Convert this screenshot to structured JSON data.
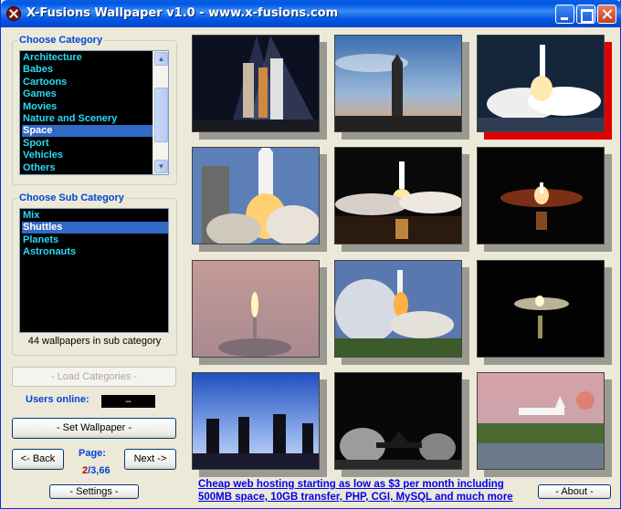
{
  "window": {
    "title": "X-Fusions Wallpaper v1.0  -  www.x-fusions.com"
  },
  "category": {
    "label": "Choose Category",
    "items": [
      "Architecture",
      "Babes",
      "Cartoons",
      "Games",
      "Movies",
      "Nature and Scenery",
      "Space",
      "Sport",
      "Vehicles",
      "Others"
    ],
    "selected": "Space"
  },
  "subcategory": {
    "label": "Choose Sub Category",
    "items": [
      "Mix",
      "Shuttles",
      "Planets",
      "Astronauts"
    ],
    "selected": "Shuttles",
    "count_text": "44 wallpapers in sub category"
  },
  "buttons": {
    "load_categories": "- Load Categories -",
    "set_wallpaper": "- Set Wallpaper -",
    "back": "<- Back",
    "next": "Next ->",
    "settings": "- Settings -",
    "about": "- About -"
  },
  "users_online": {
    "label": "Users online:",
    "value": "–"
  },
  "page": {
    "label": "Page:",
    "current": "2",
    "total": "/3,66"
  },
  "ad": {
    "line1": "Cheap web hosting starting as low as $3 per month including",
    "line2": "500MB space, 10GB transfer, PHP, CGI, MySQL and much more"
  },
  "thumbnails": [
    {
      "scene": "launchpad-night",
      "selected": false
    },
    {
      "scene": "shuttle-sunset-pad",
      "selected": false
    },
    {
      "scene": "liftoff-day-clouds",
      "selected": true
    },
    {
      "scene": "liftoff-tower-closeup",
      "selected": false
    },
    {
      "scene": "liftoff-night-reflection",
      "selected": false
    },
    {
      "scene": "liftoff-dark-water",
      "selected": false
    },
    {
      "scene": "ascent-dusk-plume",
      "selected": false
    },
    {
      "scene": "liftoff-evening-smoke",
      "selected": false
    },
    {
      "scene": "night-launch-distant",
      "selected": false
    },
    {
      "scene": "photographers-silhouette",
      "selected": false
    },
    {
      "scene": "shuttle-landing-night",
      "selected": false
    },
    {
      "scene": "shuttle-landing-runway",
      "selected": false
    }
  ],
  "colors": {
    "list_text": "#2bd9f5",
    "list_selected_bg": "#316ac5",
    "label_blue": "#0046d5",
    "selected_shadow": "#e00000",
    "page_current": "#c00000"
  }
}
